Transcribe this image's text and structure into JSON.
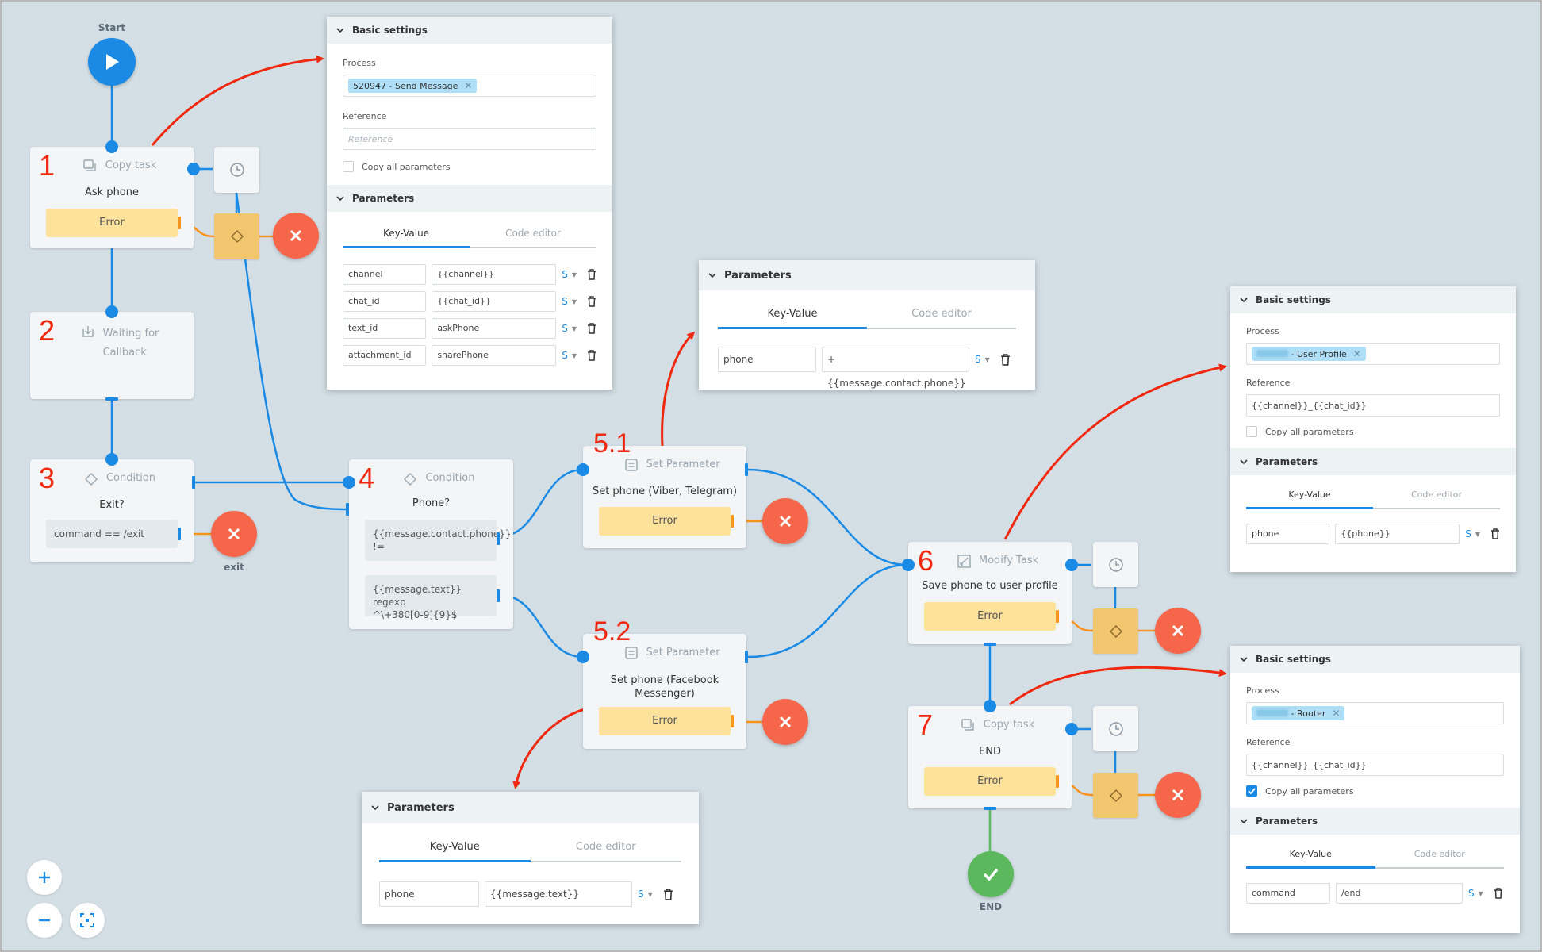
{
  "canvas": {
    "start_label": "Start",
    "end_label": "END",
    "exit_label": "exit",
    "colors": {
      "background": "#d3dfe5",
      "flow_line": "#1a8ae5",
      "error_line": "#f7931e",
      "annotation_arrow": "#f0280f",
      "error_button": "#f5664b",
      "end_button": "#5cb85c",
      "error_bar": "#fde29b"
    }
  },
  "nodes": [
    {
      "num": "1",
      "type": "Copy task",
      "icon": "copy-icon",
      "title": "Ask phone",
      "error_label": "Error"
    },
    {
      "num": "2",
      "type": "Waiting for Callback",
      "type_line1": "Waiting for",
      "type_line2": "Callback",
      "icon": "callback-download-icon"
    },
    {
      "num": "3",
      "type": "Condition",
      "icon": "condition-diamond-icon",
      "title": "Exit?",
      "conditions": [
        "command == /exit"
      ]
    },
    {
      "num": "4",
      "type": "Condition",
      "icon": "condition-diamond-icon",
      "title": "Phone?",
      "conditions": [
        {
          "line1": "{{message.contact.phone}}",
          "line2": "!="
        },
        {
          "line1": "{{message.text}} regexp",
          "line2": "^\\+380[0-9]{9}$"
        }
      ]
    },
    {
      "num": "5.1",
      "type": "Set Parameter",
      "icon": "set-parameter-icon",
      "title": "Set phone (Viber, Telegram)",
      "error_label": "Error"
    },
    {
      "num": "5.2",
      "type": "Set Parameter",
      "icon": "set-parameter-icon",
      "title_line1": "Set phone (Facebook",
      "title_line2": "Messenger)",
      "error_label": "Error"
    },
    {
      "num": "6",
      "type": "Modify Task",
      "icon": "modify-task-icon",
      "title": "Save phone to user profile",
      "error_label": "Error"
    },
    {
      "num": "7",
      "type": "Copy task",
      "icon": "copy-icon",
      "title": "END",
      "error_label": "Error"
    }
  ],
  "panels": {
    "node1": {
      "basic_settings_title": "Basic settings",
      "process_label": "Process",
      "process_chip": "520947 - Send Message",
      "reference_label": "Reference",
      "reference_placeholder": "Reference",
      "reference_value": "",
      "copy_all_label": "Copy all parameters",
      "copy_all_checked": false,
      "parameters_title": "Parameters",
      "tabs": [
        "Key-Value",
        "Code editor"
      ],
      "active_tab": "Key-Value",
      "params": [
        {
          "key": "channel",
          "value": "{{channel}}",
          "type": "S"
        },
        {
          "key": "chat_id",
          "value": "{{chat_id}}",
          "type": "S"
        },
        {
          "key": "text_id",
          "value": "askPhone",
          "type": "S"
        },
        {
          "key": "attachment_id",
          "value": "sharePhone",
          "type": "S"
        }
      ]
    },
    "node51": {
      "parameters_title": "Parameters",
      "tabs": [
        "Key-Value",
        "Code editor"
      ],
      "params": [
        {
          "key": "phone",
          "value": "+{{message.contact.phone}}",
          "type": "S"
        }
      ]
    },
    "node52": {
      "parameters_title": "Parameters",
      "tabs": [
        "Key-Value",
        "Code editor"
      ],
      "params": [
        {
          "key": "phone",
          "value": "{{message.text}}",
          "type": "S"
        }
      ]
    },
    "node6": {
      "basic_settings_title": "Basic settings",
      "process_label": "Process",
      "process_chip": " - User Profile",
      "reference_label": "Reference",
      "reference_value": "{{channel}}_{{chat_id}}",
      "copy_all_label": "Copy all parameters",
      "copy_all_checked": false,
      "parameters_title": "Parameters",
      "tabs": [
        "Key-Value",
        "Code editor"
      ],
      "params": [
        {
          "key": "phone",
          "value": "{{phone}}",
          "type": "S"
        }
      ]
    },
    "node7": {
      "basic_settings_title": "Basic settings",
      "process_label": "Process",
      "process_chip": " - Router",
      "reference_label": "Reference",
      "reference_value": "{{channel}}_{{chat_id}}",
      "copy_all_label": "Copy all parameters",
      "copy_all_checked": true,
      "parameters_title": "Parameters",
      "tabs": [
        "Key-Value",
        "Code editor"
      ],
      "params": [
        {
          "key": "command",
          "value": "/end",
          "type": "S"
        }
      ]
    }
  },
  "zoom_controls": {
    "zoom_in": "+",
    "zoom_out": "−",
    "fit": "fit-to-screen"
  }
}
